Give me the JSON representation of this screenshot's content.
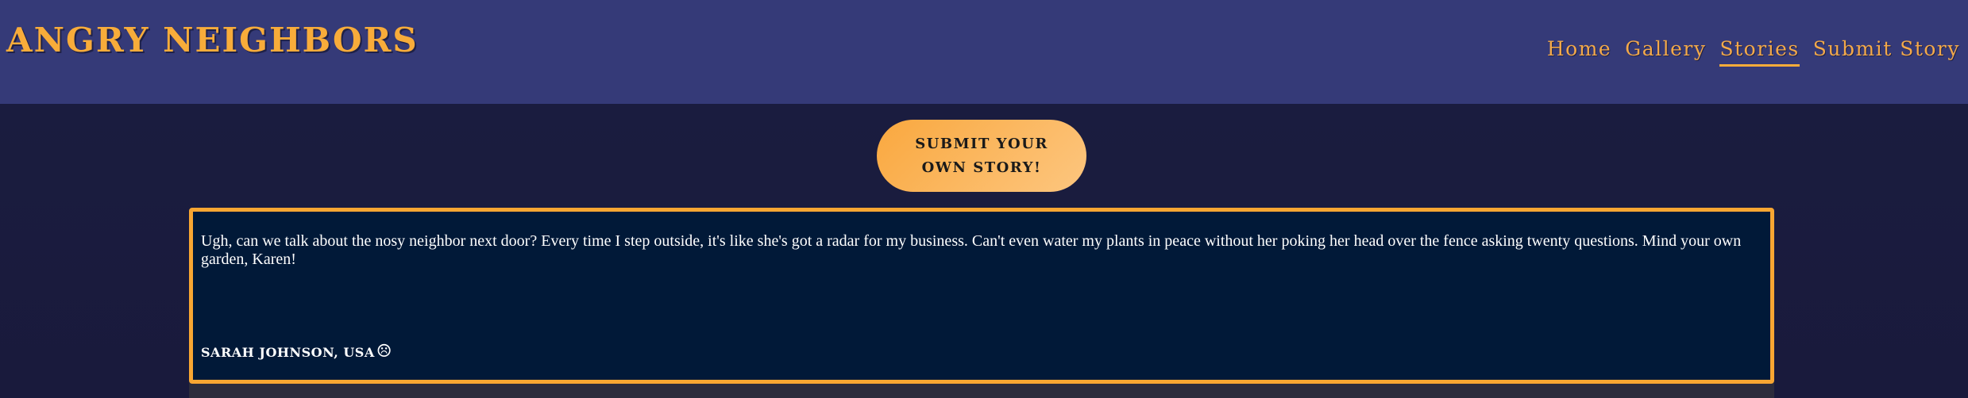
{
  "header": {
    "logo": "ANGRY NEIGHBORS",
    "nav": [
      {
        "label": "Home",
        "active": false
      },
      {
        "label": "Gallery",
        "active": false
      },
      {
        "label": "Stories",
        "active": true
      },
      {
        "label": "Submit Story",
        "active": false
      }
    ]
  },
  "main": {
    "submit_button": {
      "line1": "SUBMIT YOUR",
      "line2": "OWN STORY!"
    },
    "stories": [
      {
        "text": "Ugh, can we talk about the nosy neighbor next door? Every time I step outside, it's like she's got a radar for my business. Can't even water my plants in peace without her poking her head over the fence asking twenty questions. Mind your own garden, Karen!",
        "author": "SARAH JOHNSON, USA",
        "emoji": "☹",
        "emoji_icon": "frowning-face-icon"
      }
    ]
  },
  "colors": {
    "header_bg": "#353a78",
    "page_bg": "#1b1d40",
    "accent": "#f8ac3a",
    "card_bg": "#011938"
  }
}
